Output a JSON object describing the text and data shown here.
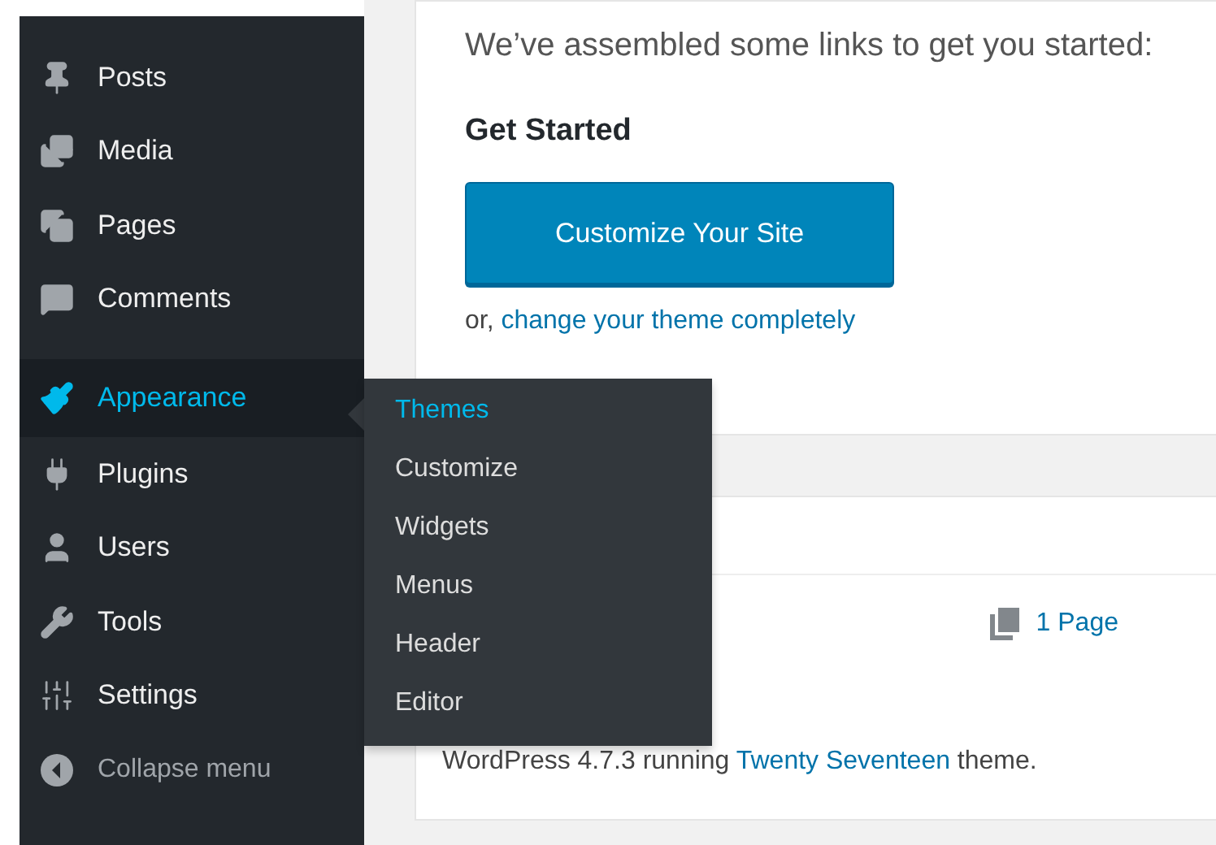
{
  "sidebar": {
    "items": [
      {
        "kind": "link",
        "label": "Posts",
        "selected": false
      },
      {
        "kind": "link",
        "label": "Media",
        "selected": false
      },
      {
        "kind": "link",
        "label": "Pages",
        "selected": false
      },
      {
        "kind": "link",
        "label": "Comments",
        "selected": false
      },
      {
        "kind": "link",
        "label": "Appearance",
        "selected": true,
        "submenu": [
          {
            "label": "Themes",
            "selected": true
          },
          {
            "label": "Customize",
            "selected": false
          },
          {
            "label": "Widgets",
            "selected": false
          },
          {
            "label": "Menus",
            "selected": false
          },
          {
            "label": "Header",
            "selected": false
          },
          {
            "label": "Editor",
            "selected": false
          }
        ]
      },
      {
        "kind": "link",
        "label": "Plugins",
        "selected": false
      },
      {
        "kind": "link",
        "label": "Users",
        "selected": false
      },
      {
        "kind": "link",
        "label": "Tools",
        "selected": false
      },
      {
        "kind": "link",
        "label": "Settings",
        "selected": false
      },
      {
        "kind": "collapse",
        "label": "Collapse menu",
        "selected": false
      }
    ]
  },
  "welcome": {
    "intro": "We’ve assembled some links to get you started:",
    "heading": "Get Started",
    "button": "Customize Your Site",
    "alt_prefix": "or, ",
    "alt_link": "change your theme completely"
  },
  "glance": {
    "count": "1 Page",
    "footer_prefix": "WordPress 4.7.3 running ",
    "footer_link": "Twenty Seventeen",
    "footer_suffix": " theme."
  }
}
